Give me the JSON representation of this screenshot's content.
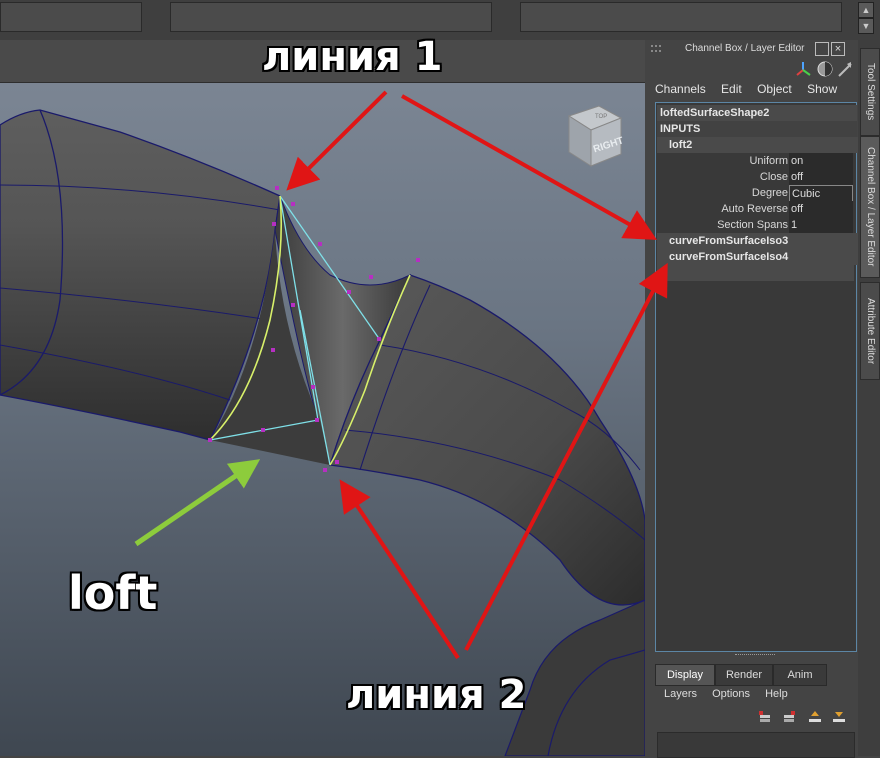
{
  "channel_box": {
    "title": "Channel Box / Layer Editor",
    "menu": [
      "Channels",
      "Edit",
      "Object",
      "Show"
    ],
    "shape_name": "loftedSurfaceShape2",
    "inputs_label": "INPUTS",
    "node_name": "loft2",
    "attributes": [
      {
        "label": "Uniform",
        "value": "on"
      },
      {
        "label": "Close",
        "value": "off"
      },
      {
        "label": "Degree",
        "value": "Cubic"
      },
      {
        "label": "Auto Reverse",
        "value": "off"
      },
      {
        "label": "Section Spans",
        "value": "1"
      }
    ],
    "extra_nodes": [
      "curveFromSurfaceIso3",
      "curveFromSurfaceIso4"
    ]
  },
  "side_tabs": [
    "Tool Settings",
    "Channel Box / Layer Editor",
    "Attribute Editor"
  ],
  "layer_editor": {
    "tabs": [
      "Display",
      "Render",
      "Anim"
    ],
    "menu": [
      "Layers",
      "Options",
      "Help"
    ],
    "icons": [
      "new-layer-icon",
      "new-layer-selected-icon",
      "move-layer-up-icon",
      "move-layer-down-icon"
    ]
  },
  "viewcube": {
    "label": "RIGHT",
    "top_label": "TOP"
  },
  "annotations": {
    "line1": "линия 1",
    "line2": "линия 2",
    "loft": "loft"
  },
  "colors": {
    "arrow_red": "#e01515",
    "arrow_green": "#8dcc3c",
    "curve_highlight": "#d8f06a",
    "loft_edges": "#7fe0e8",
    "cv_points": "#b62fc2",
    "selection_border": "#5c86a5"
  }
}
